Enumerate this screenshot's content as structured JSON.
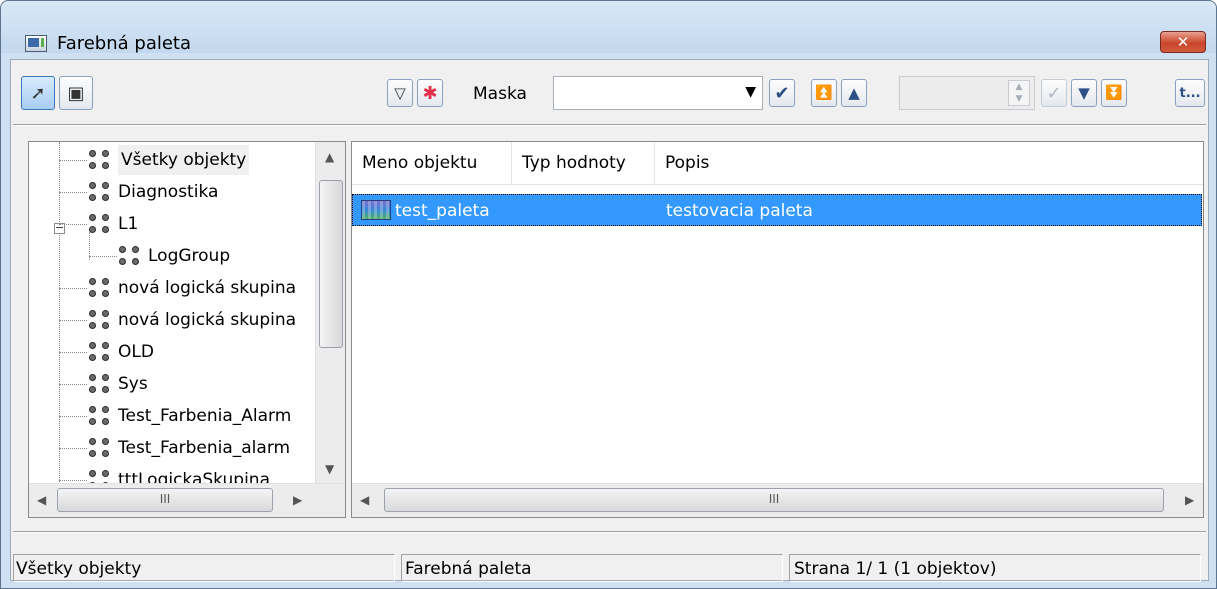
{
  "window": {
    "title": "Farebná paleta",
    "close_label": "✕"
  },
  "toolbar": {
    "mask_label": "Maska",
    "mask_value": "",
    "buttons": {
      "select": "select-pointer-icon",
      "open": "open-door-icon",
      "filter": "filter-icon",
      "clear_filter": "clear-asterisk-icon",
      "confirm_mask": "checkmark-icon",
      "first": "first-page-icon",
      "prev": "previous-page-icon",
      "apply_page": "checkmark-icon",
      "next": "next-page-icon",
      "last": "last-page-icon",
      "more": "t..."
    }
  },
  "tree": {
    "items": [
      {
        "label": "Všetky objekty",
        "level": 0
      },
      {
        "label": "Diagnostika",
        "level": 0
      },
      {
        "label": "L1",
        "level": 0,
        "expanded": true
      },
      {
        "label": "LogGroup",
        "level": 1
      },
      {
        "label": "nová logická skupina",
        "level": 0
      },
      {
        "label": "nová logická skupina",
        "level": 0
      },
      {
        "label": "OLD",
        "level": 0
      },
      {
        "label": "Sys",
        "level": 0
      },
      {
        "label": "Test_Farbenia_Alarm",
        "level": 0
      },
      {
        "label": "Test_Farbenia_alarm",
        "level": 0
      },
      {
        "label": "tttLogickaSkupina",
        "level": 0
      }
    ]
  },
  "list": {
    "columns": [
      "Meno objektu",
      "Typ hodnoty",
      "Popis"
    ],
    "rows": [
      {
        "name": "test_paleta",
        "type": "",
        "description": "testovacia paleta",
        "selected": true
      }
    ],
    "scroll_grip": "III"
  },
  "statusbar": {
    "pane1": "Všetky objekty",
    "pane2": "Farebná paleta",
    "pane3": "Strana  1/ 1   (1 objektov)"
  },
  "colors": {
    "selection": "#3399ff",
    "title_bar": "#cfe0f3",
    "close_button": "#c9452b"
  }
}
